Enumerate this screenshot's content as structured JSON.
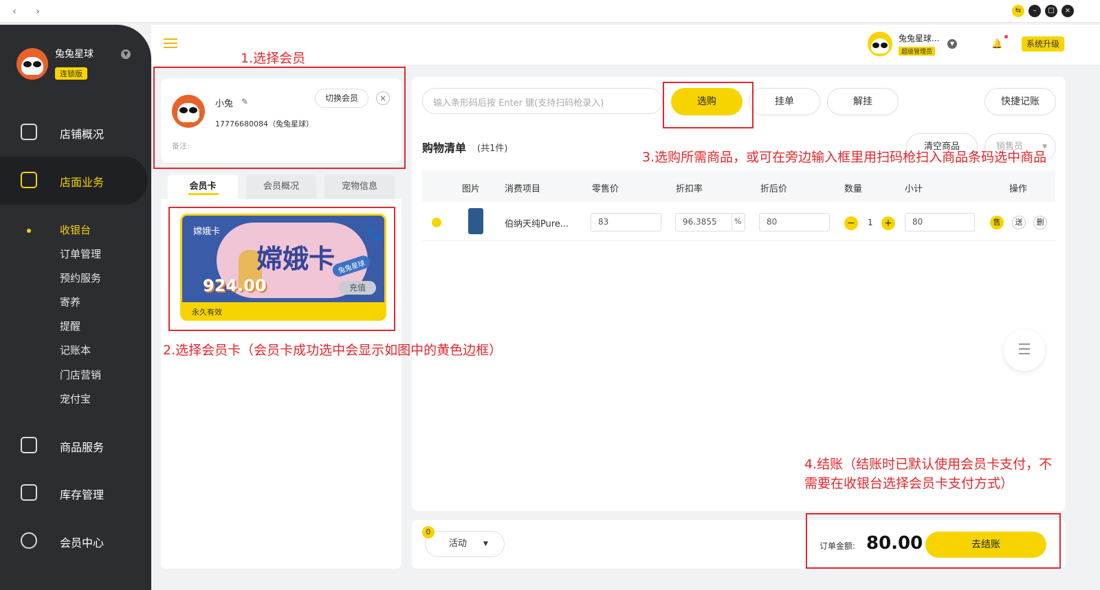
{
  "titlebar": {
    "back": "‹",
    "forward": "›"
  },
  "sidebar": {
    "brand_name": "兔兔星球",
    "brand_badge": "连锁版",
    "menu": [
      {
        "label": "店铺概况",
        "icon": "dashboard-icon"
      },
      {
        "label": "店面业务",
        "icon": "home-icon"
      },
      {
        "label": "商品服务",
        "icon": "bag-icon"
      },
      {
        "label": "库存管理",
        "icon": "box-icon"
      },
      {
        "label": "会员中心",
        "icon": "member-icon"
      }
    ],
    "submenu": [
      "收银台",
      "订单管理",
      "预约服务",
      "寄养",
      "提醒",
      "记账本",
      "门店营销",
      "宠付宝"
    ]
  },
  "header": {
    "user_name": "兔兔星球...",
    "role": "超级管理员",
    "upgrade": "系统升级"
  },
  "member": {
    "name": "小兔",
    "phone": "17776680084（兔兔星球）",
    "switch_btn": "切换会员",
    "remark_label": "备注:",
    "tabs": [
      "会员卡",
      "会员概况",
      "宠物信息"
    ]
  },
  "card": {
    "title": "嫦娥卡",
    "big_title": "嫦娥卡",
    "amount": "924.00",
    "recharge": "充值",
    "validity": "永久有效",
    "stamp": "兔兔星球"
  },
  "toolbar": {
    "search_placeholder": "输入条形码后按 Enter 键(支持扫码枪录入)",
    "select": "选购",
    "hang": "挂单",
    "unhang": "解挂",
    "quick": "快捷记账"
  },
  "cart": {
    "title": "购物清单",
    "count": "(共1件)",
    "clear": "清空商品",
    "seller": "销售员",
    "headers": [
      "图片",
      "消费项目",
      "零售价",
      "折扣率",
      "折后价",
      "数量",
      "小计",
      "操作"
    ],
    "row": {
      "name": "伯纳天纯Pure...",
      "price": "83",
      "discount": "96.3855",
      "percent": "%",
      "after": "80",
      "qty": "1",
      "subtotal": "80",
      "sell": "售",
      "give": "送",
      "del": "删"
    }
  },
  "footer": {
    "badge": "0",
    "activity": "活动",
    "order_label": "订单金额:",
    "order_amount": "80.00",
    "checkout": "去结账"
  },
  "annotations": {
    "a1": "1.选择会员",
    "a2": "2.选择会员卡（会员卡成功选中会显示如图中的黄色边框）",
    "a3": "3.选购所需商品，或可在旁边输入框里用扫码枪扫入商品条码选中商品",
    "a4": "4.结账（结账时已默认使用会员卡支付，不需要在收银台选择会员卡支付方式）"
  },
  "colors": {
    "accent": "#f7d400",
    "annotation": "#e5262b",
    "sidebar": "#2b2d31"
  }
}
